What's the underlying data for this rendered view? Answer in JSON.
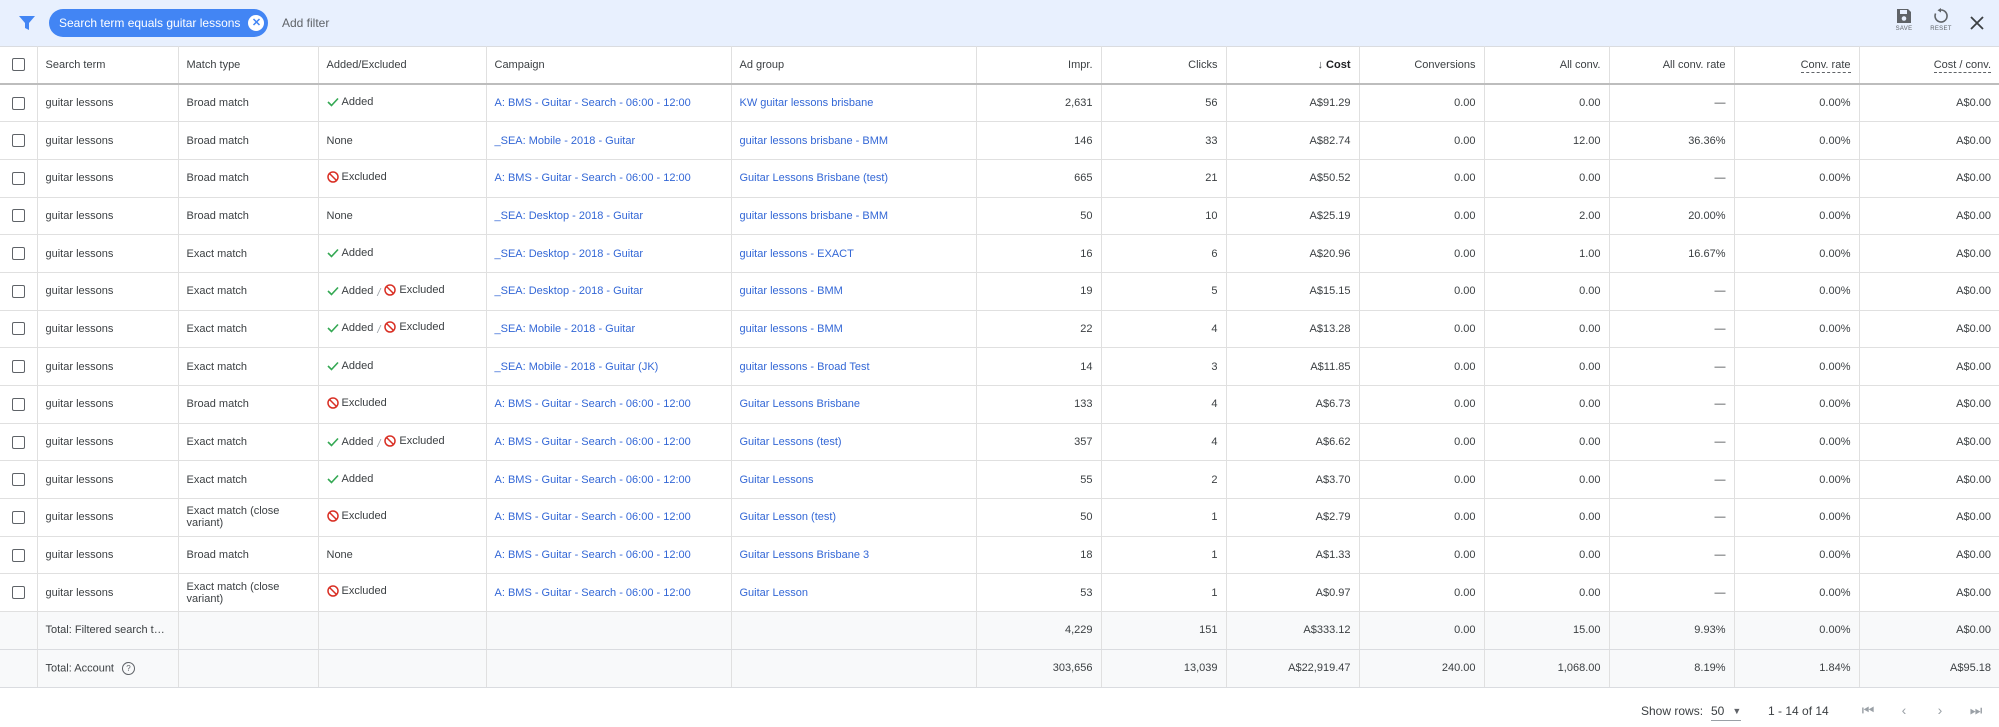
{
  "filter": {
    "chip_label": "Search term equals guitar lessons",
    "add_filter": "Add filter",
    "save_label": "SAVE",
    "reset_label": "RESET"
  },
  "columns": {
    "search_term": "Search term",
    "match_type": "Match type",
    "added_excluded": "Added/Excluded",
    "campaign": "Campaign",
    "ad_group": "Ad group",
    "impr": "Impr.",
    "clicks": "Clicks",
    "cost": "Cost",
    "conversions": "Conversions",
    "all_conv": "All conv.",
    "all_conv_rate": "All conv. rate",
    "conv_rate": "Conv. rate",
    "cost_conv": "Cost / conv."
  },
  "status_text": {
    "added": "Added",
    "excluded": "Excluded",
    "none": "None"
  },
  "rows": [
    {
      "term": "guitar lessons",
      "match": "Broad match",
      "status": "added",
      "campaign": "A: BMS - Guitar - Search - 06:00 - 12:00",
      "adgroup": "KW guitar lessons brisbane",
      "impr": "2,631",
      "clicks": "56",
      "cost": "A$91.29",
      "conv": "0.00",
      "allconv": "0.00",
      "allrate": "—",
      "convrate": "0.00%",
      "costconv": "A$0.00"
    },
    {
      "term": "guitar lessons",
      "match": "Broad match",
      "status": "none",
      "campaign": "_SEA: Mobile - 2018 - Guitar",
      "adgroup": "guitar lessons brisbane - BMM",
      "impr": "146",
      "clicks": "33",
      "cost": "A$82.74",
      "conv": "0.00",
      "allconv": "12.00",
      "allrate": "36.36%",
      "convrate": "0.00%",
      "costconv": "A$0.00"
    },
    {
      "term": "guitar lessons",
      "match": "Broad match",
      "status": "excluded",
      "campaign": "A: BMS - Guitar - Search - 06:00 - 12:00",
      "adgroup": "Guitar Lessons Brisbane (test)",
      "impr": "665",
      "clicks": "21",
      "cost": "A$50.52",
      "conv": "0.00",
      "allconv": "0.00",
      "allrate": "—",
      "convrate": "0.00%",
      "costconv": "A$0.00"
    },
    {
      "term": "guitar lessons",
      "match": "Broad match",
      "status": "none",
      "campaign": "_SEA: Desktop - 2018 - Guitar",
      "adgroup": "guitar lessons brisbane - BMM",
      "impr": "50",
      "clicks": "10",
      "cost": "A$25.19",
      "conv": "0.00",
      "allconv": "2.00",
      "allrate": "20.00%",
      "convrate": "0.00%",
      "costconv": "A$0.00"
    },
    {
      "term": "guitar lessons",
      "match": "Exact match",
      "status": "added",
      "campaign": "_SEA: Desktop - 2018 - Guitar",
      "adgroup": "guitar lessons - EXACT",
      "impr": "16",
      "clicks": "6",
      "cost": "A$20.96",
      "conv": "0.00",
      "allconv": "1.00",
      "allrate": "16.67%",
      "convrate": "0.00%",
      "costconv": "A$0.00"
    },
    {
      "term": "guitar lessons",
      "match": "Exact match",
      "status": "both",
      "campaign": "_SEA: Desktop - 2018 - Guitar",
      "adgroup": "guitar lessons - BMM",
      "impr": "19",
      "clicks": "5",
      "cost": "A$15.15",
      "conv": "0.00",
      "allconv": "0.00",
      "allrate": "—",
      "convrate": "0.00%",
      "costconv": "A$0.00"
    },
    {
      "term": "guitar lessons",
      "match": "Exact match",
      "status": "both",
      "campaign": "_SEA: Mobile - 2018 - Guitar",
      "adgroup": "guitar lessons - BMM",
      "impr": "22",
      "clicks": "4",
      "cost": "A$13.28",
      "conv": "0.00",
      "allconv": "0.00",
      "allrate": "—",
      "convrate": "0.00%",
      "costconv": "A$0.00"
    },
    {
      "term": "guitar lessons",
      "match": "Exact match",
      "status": "added",
      "campaign": "_SEA: Mobile - 2018 - Guitar (JK)",
      "adgroup": "guitar lessons - Broad Test",
      "impr": "14",
      "clicks": "3",
      "cost": "A$11.85",
      "conv": "0.00",
      "allconv": "0.00",
      "allrate": "—",
      "convrate": "0.00%",
      "costconv": "A$0.00"
    },
    {
      "term": "guitar lessons",
      "match": "Broad match",
      "status": "excluded",
      "campaign": "A: BMS - Guitar - Search - 06:00 - 12:00",
      "adgroup": "Guitar Lessons Brisbane",
      "impr": "133",
      "clicks": "4",
      "cost": "A$6.73",
      "conv": "0.00",
      "allconv": "0.00",
      "allrate": "—",
      "convrate": "0.00%",
      "costconv": "A$0.00"
    },
    {
      "term": "guitar lessons",
      "match": "Exact match",
      "status": "both",
      "campaign": "A: BMS - Guitar - Search - 06:00 - 12:00",
      "adgroup": "Guitar Lessons (test)",
      "impr": "357",
      "clicks": "4",
      "cost": "A$6.62",
      "conv": "0.00",
      "allconv": "0.00",
      "allrate": "—",
      "convrate": "0.00%",
      "costconv": "A$0.00"
    },
    {
      "term": "guitar lessons",
      "match": "Exact match",
      "status": "added",
      "campaign": "A: BMS - Guitar - Search - 06:00 - 12:00",
      "adgroup": "Guitar Lessons",
      "impr": "55",
      "clicks": "2",
      "cost": "A$3.70",
      "conv": "0.00",
      "allconv": "0.00",
      "allrate": "—",
      "convrate": "0.00%",
      "costconv": "A$0.00"
    },
    {
      "term": "guitar lessons",
      "match": "Exact match (close variant)",
      "status": "excluded",
      "campaign": "A: BMS - Guitar - Search - 06:00 - 12:00",
      "adgroup": "Guitar Lesson (test)",
      "impr": "50",
      "clicks": "1",
      "cost": "A$2.79",
      "conv": "0.00",
      "allconv": "0.00",
      "allrate": "—",
      "convrate": "0.00%",
      "costconv": "A$0.00"
    },
    {
      "term": "guitar lessons",
      "match": "Broad match",
      "status": "none",
      "campaign": "A: BMS - Guitar - Search - 06:00 - 12:00",
      "adgroup": "Guitar Lessons Brisbane 3",
      "impr": "18",
      "clicks": "1",
      "cost": "A$1.33",
      "conv": "0.00",
      "allconv": "0.00",
      "allrate": "—",
      "convrate": "0.00%",
      "costconv": "A$0.00"
    },
    {
      "term": "guitar lessons",
      "match": "Exact match (close variant)",
      "status": "excluded",
      "campaign": "A: BMS - Guitar - Search - 06:00 - 12:00",
      "adgroup": "Guitar Lesson",
      "impr": "53",
      "clicks": "1",
      "cost": "A$0.97",
      "conv": "0.00",
      "allconv": "0.00",
      "allrate": "—",
      "convrate": "0.00%",
      "costconv": "A$0.00"
    }
  ],
  "totals": [
    {
      "label": "Total: Filtered search ter...",
      "help": false,
      "impr": "4,229",
      "clicks": "151",
      "cost": "A$333.12",
      "conv": "0.00",
      "allconv": "15.00",
      "allrate": "9.93%",
      "convrate": "0.00%",
      "costconv": "A$0.00"
    },
    {
      "label": "Total: Account",
      "help": true,
      "impr": "303,656",
      "clicks": "13,039",
      "cost": "A$22,919.47",
      "conv": "240.00",
      "allconv": "1,068.00",
      "allrate": "8.19%",
      "convrate": "1.84%",
      "costconv": "A$95.18"
    }
  ],
  "pagination": {
    "show_rows_label": "Show rows:",
    "rows_value": "50",
    "range": "1 - 14 of 14"
  },
  "colors": {
    "accent": "#4285f4",
    "link": "#3367d6",
    "added": "#34a853",
    "excluded": "#d93025",
    "filter_bg": "#e8f0fe"
  }
}
